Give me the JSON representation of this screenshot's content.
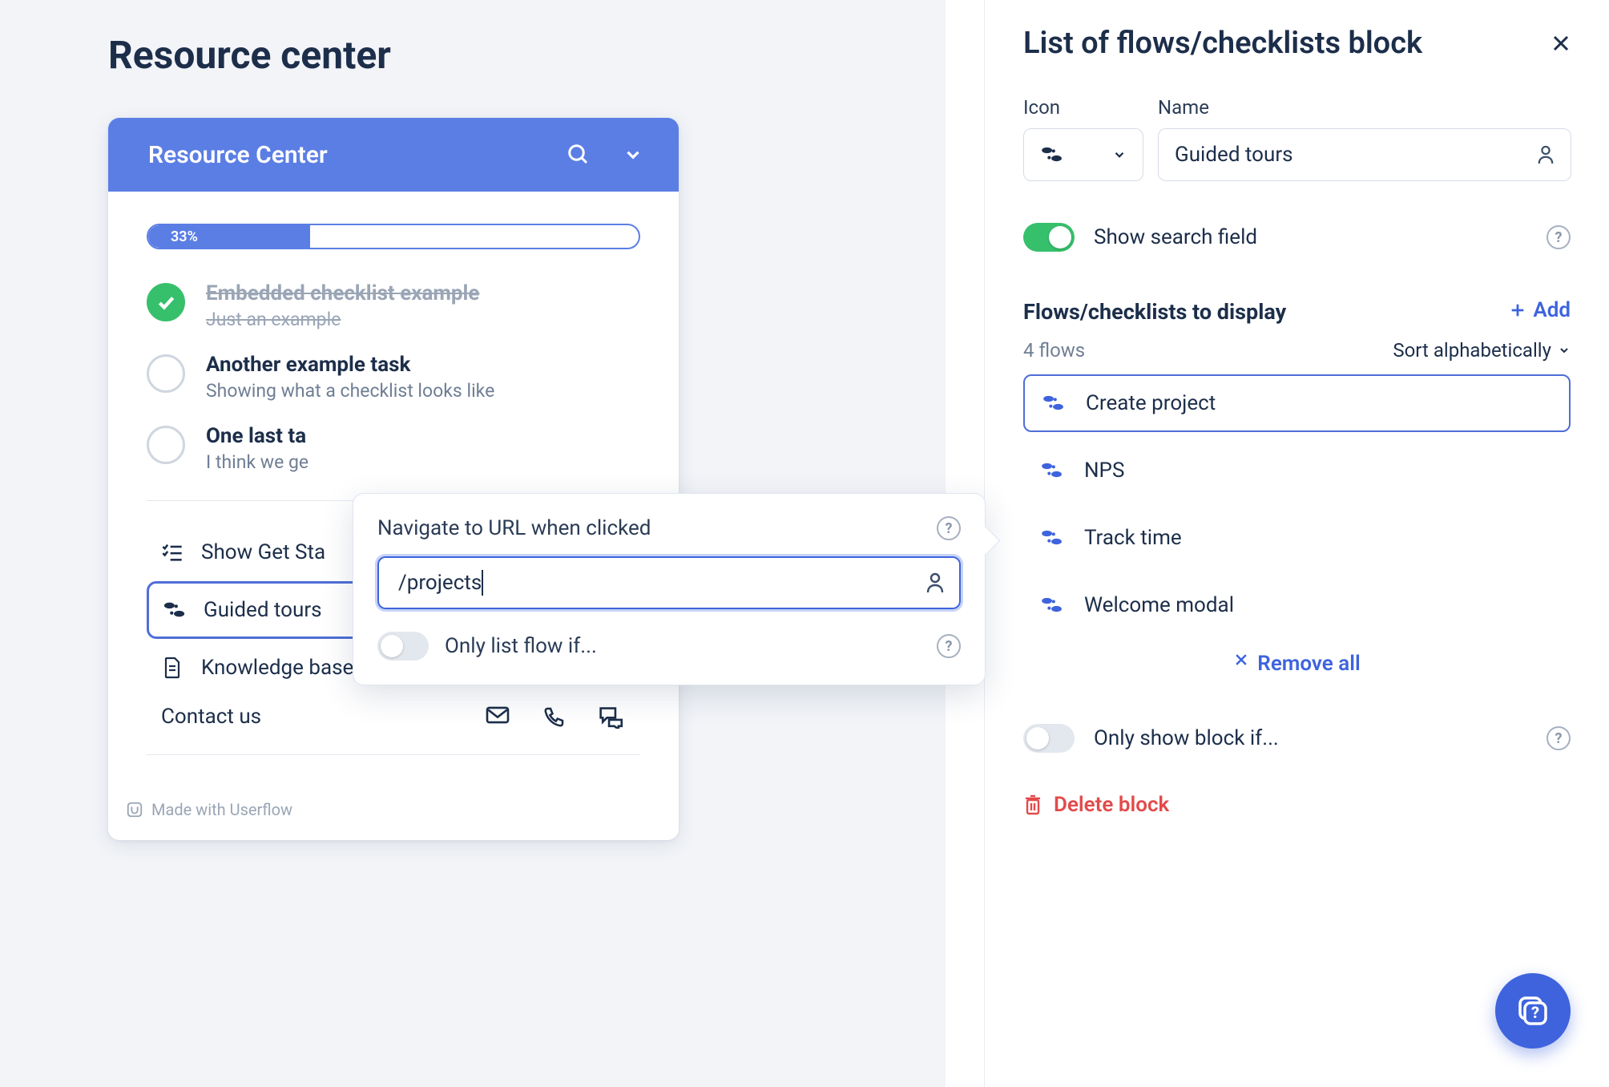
{
  "page_title": "Resource center",
  "resource_center": {
    "header_title": "Resource Center",
    "progress_percent": 33,
    "progress_label": "33%",
    "tasks": [
      {
        "title": "Embedded checklist example",
        "subtitle": "Just an example",
        "done": true
      },
      {
        "title": "Another example task",
        "subtitle": "Showing what a checklist looks like",
        "done": false
      },
      {
        "title": "One last ta",
        "subtitle": "I think we ge",
        "done": false
      }
    ],
    "links": {
      "getting_started": "Show Get Sta",
      "guided_tours": "Guided tours",
      "knowledge_base": "Knowledge base",
      "contact_us": "Contact us"
    },
    "footer": "Made with Userflow"
  },
  "popover": {
    "title": "Navigate to URL when clicked",
    "url_value": "/projects",
    "condition_label": "Only list flow if..."
  },
  "panel": {
    "title": "List of flows/checklists block",
    "icon_field_label": "Icon",
    "name_field_label": "Name",
    "name_value": "Guided tours",
    "show_search_label": "Show search field",
    "show_search_on": true,
    "flows_section_title": "Flows/checklists to display",
    "add_label": "Add",
    "flows_count_label": "4 flows",
    "sort_label": "Sort alphabetically",
    "flows": [
      {
        "label": "Create project",
        "selected": true
      },
      {
        "label": "NPS",
        "selected": false
      },
      {
        "label": "Track time",
        "selected": false
      },
      {
        "label": "Welcome modal",
        "selected": false
      }
    ],
    "remove_all_label": "Remove all",
    "only_show_label": "Only show block if...",
    "only_show_on": false,
    "delete_label": "Delete block"
  },
  "colors": {
    "primary": "#5b7ee5",
    "accent": "#3e63dd",
    "success": "#36c06b",
    "danger": "#e34a4a"
  }
}
